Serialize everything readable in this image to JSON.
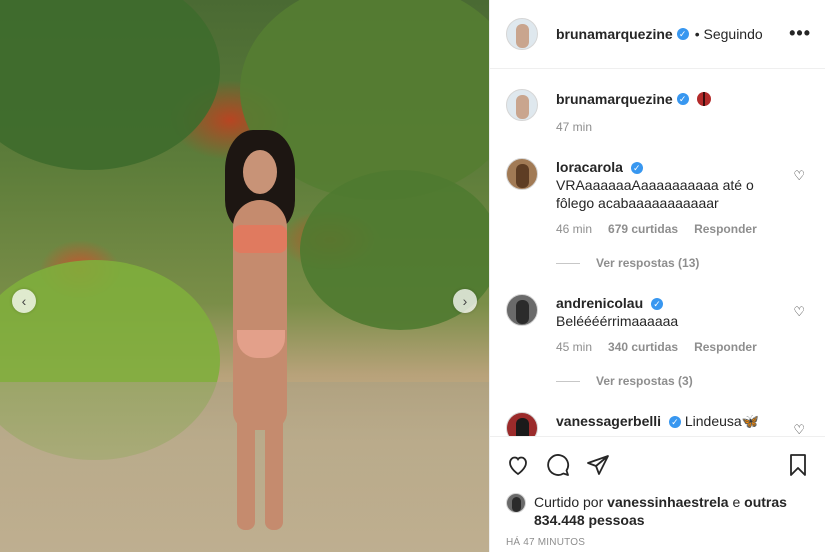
{
  "post": {
    "username": "brunamarquezine",
    "follow_label": "• Seguindo",
    "more_label": "•••"
  },
  "caption": {
    "username": "brunamarquezine",
    "time": "47 min"
  },
  "comments": [
    {
      "username": "loracarola",
      "text": "VRAaaaaaaAaaaaaaaaaa até o fôlego acabaaaaaaaaaaar",
      "time": "46 min",
      "likes": "679 curtidas",
      "reply_label": "Responder",
      "replies": "Ver respostas (13)"
    },
    {
      "username": "andrenicolau",
      "text": "Beléééérrimaaaaaa",
      "time": "45 min",
      "likes": "340 curtidas",
      "reply_label": "Responder",
      "replies": "Ver respostas (3)"
    },
    {
      "username": "vanessagerbelli",
      "text": "Lindeusa🦋"
    }
  ],
  "likes": {
    "prefix": "Curtido por ",
    "user": "vanessinhaestrela",
    "middle": " e ",
    "others": "outras 834.448 pessoas"
  },
  "posted_ago": "HÁ 47 MINUTOS",
  "icons": {
    "like": "heart-icon",
    "comment": "comment-icon",
    "share": "share-icon",
    "save": "bookmark-icon"
  },
  "colors": {
    "verified": "#3897f0",
    "text": "#262626",
    "muted": "#8e8e8e"
  }
}
